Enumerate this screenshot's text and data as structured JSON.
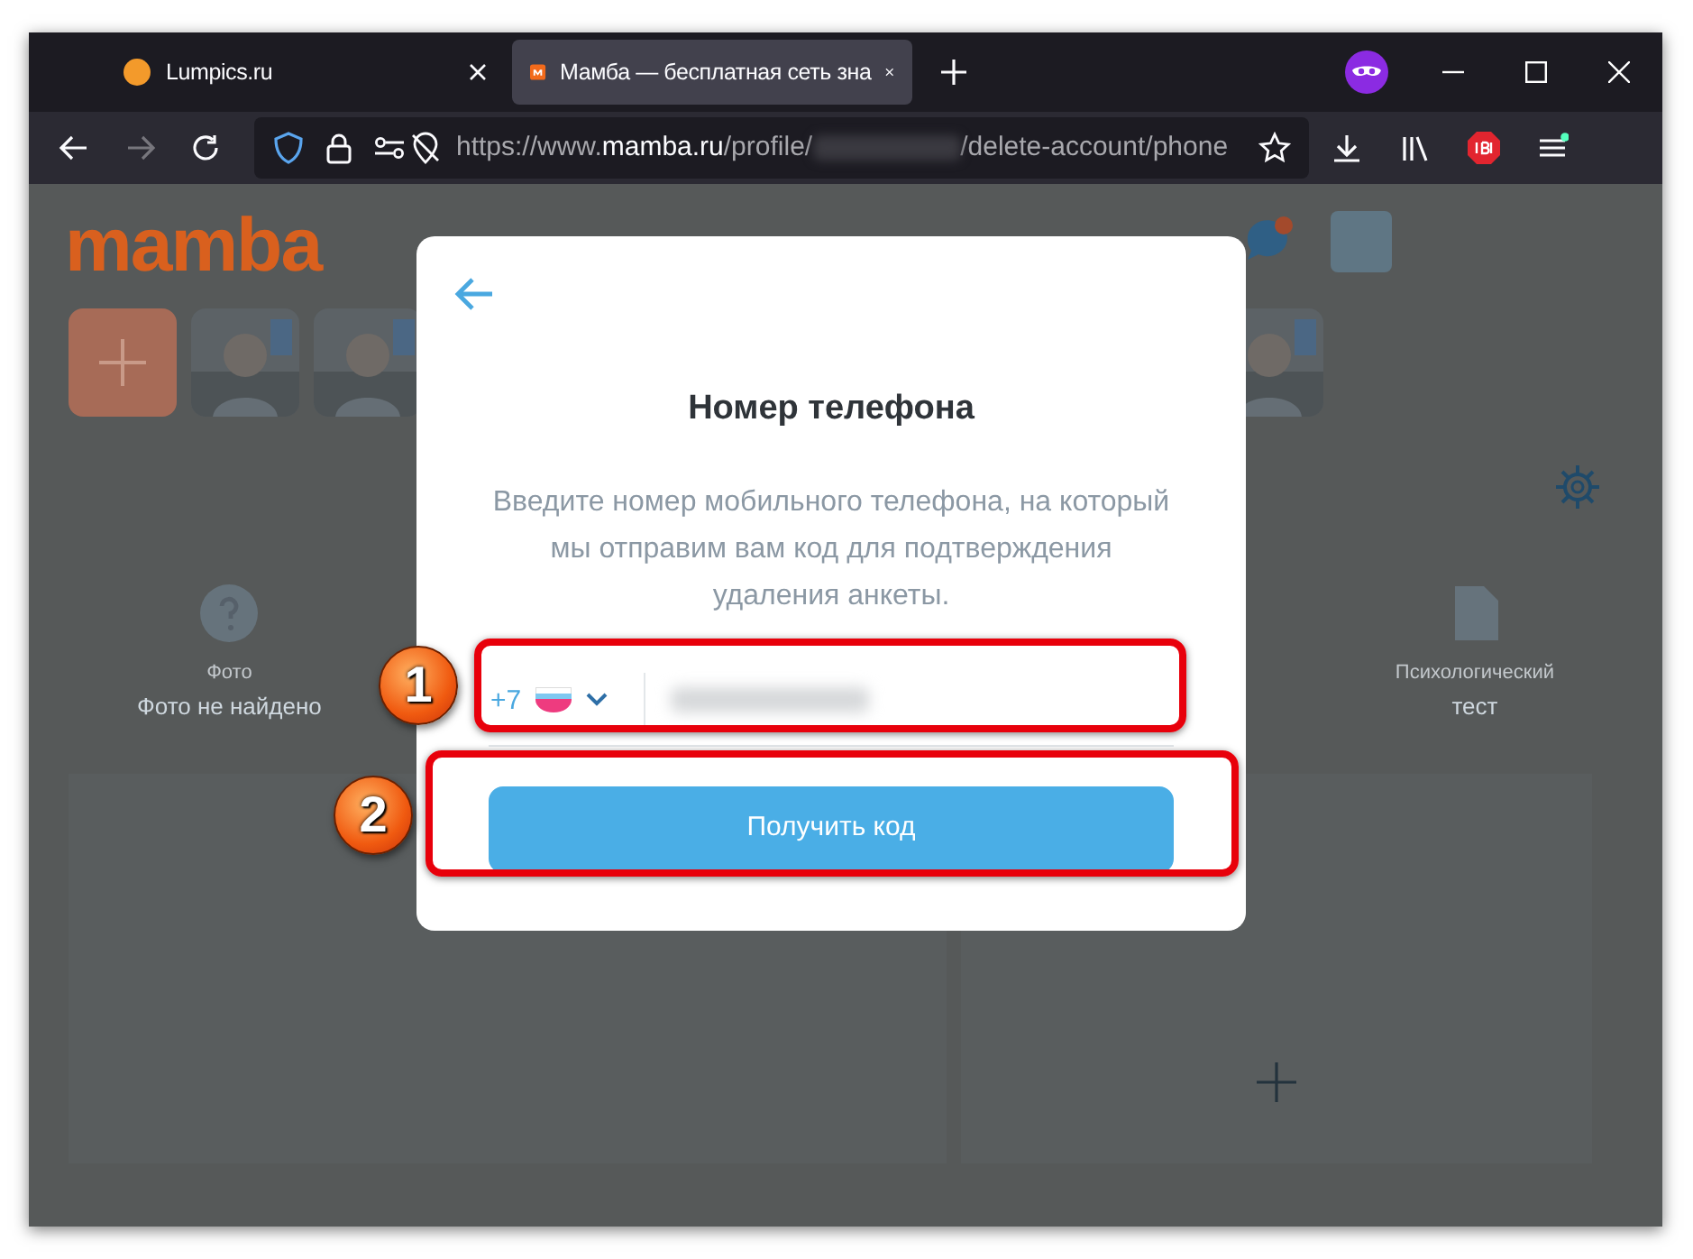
{
  "browser": {
    "tabs": [
      {
        "title": "Lumpics.ru",
        "selected": false
      },
      {
        "title": "Мамба — бесплатная сеть зна",
        "selected": true
      }
    ],
    "address": {
      "prefix": "https://www.",
      "domain": "mamba.ru",
      "path": "/profile/",
      "suffix": "/delete-account/phone"
    }
  },
  "page": {
    "logo": "mamba",
    "profile_items": [
      {
        "label": "Фото",
        "value": "Фото не найдено"
      },
      {
        "label": "Психологический",
        "value": "тест"
      }
    ]
  },
  "modal": {
    "title": "Номер телефона",
    "description": "Введите номер мобильного телефона, на который мы отправим вам код для подтверждения удаления анкеты.",
    "phone": {
      "code": "+7"
    },
    "button": "Получить код"
  },
  "annotations": [
    {
      "number": "1"
    },
    {
      "number": "2"
    }
  ]
}
